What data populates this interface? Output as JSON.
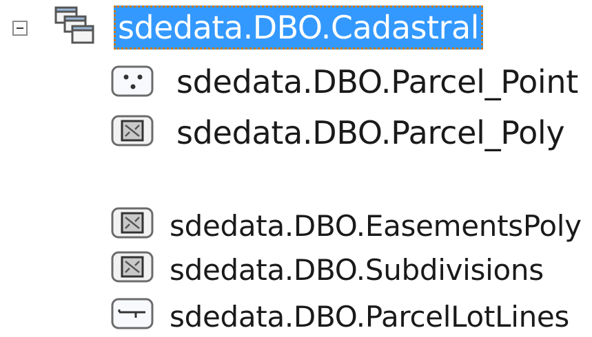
{
  "tree": {
    "root": {
      "label": "sdedata.DBO.Cadastral",
      "expanded": true,
      "selected": true,
      "icon": "feature-dataset-icon"
    },
    "children": [
      {
        "label": "sdedata.DBO.Parcel_Point",
        "icon": "point-feature-class-icon"
      },
      {
        "label": "sdedata.DBO.Parcel_Poly",
        "icon": "polygon-feature-class-icon"
      },
      {
        "label": "sdedata.DBO.EasementsPoly",
        "icon": "polygon-feature-class-icon"
      },
      {
        "label": "sdedata.DBO.Subdivisions",
        "icon": "polygon-feature-class-icon"
      },
      {
        "label": "sdedata.DBO.ParcelLotLines",
        "icon": "line-feature-class-icon"
      }
    ]
  },
  "colors": {
    "selection": "#3399ff",
    "focus_outline": "#d27a00",
    "text": "#1a1a1a"
  }
}
